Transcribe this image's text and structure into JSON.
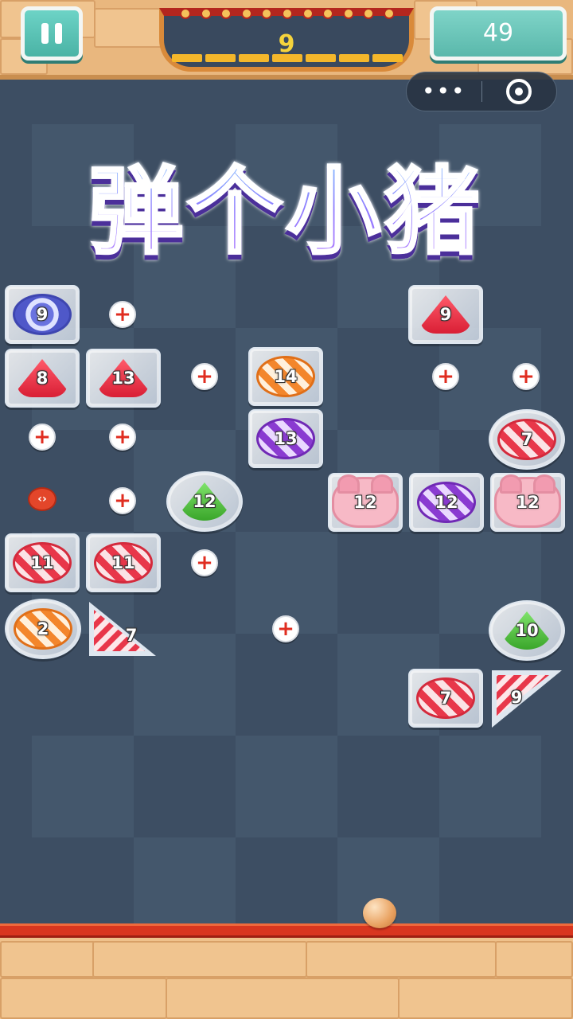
{
  "hud": {
    "level": "9",
    "balls_remaining": "49",
    "menu_more": "•••",
    "close_label": ""
  },
  "title": "弹个小猪",
  "blocks": [
    {
      "kind": "swirl",
      "value": "9"
    },
    {
      "kind": "gem-red",
      "value": "9"
    },
    {
      "kind": "gem-red",
      "value": "8"
    },
    {
      "kind": "gem-red",
      "value": "13"
    },
    {
      "kind": "candy-orange",
      "value": "14"
    },
    {
      "kind": "candy-purple",
      "value": "13"
    },
    {
      "kind": "candy-red",
      "value": "7"
    },
    {
      "kind": "gem-green",
      "value": "12"
    },
    {
      "kind": "pig",
      "value": "12"
    },
    {
      "kind": "candy-purple",
      "value": "12"
    },
    {
      "kind": "pig",
      "value": "12"
    },
    {
      "kind": "candy-red",
      "value": "11"
    },
    {
      "kind": "candy-red",
      "value": "11"
    },
    {
      "kind": "candy-orange",
      "value": "2"
    },
    {
      "kind": "striped-triangle",
      "value": "7"
    },
    {
      "kind": "gem-green",
      "value": "10"
    },
    {
      "kind": "candy-red",
      "value": "7"
    },
    {
      "kind": "striped-triangle",
      "value": "9"
    }
  ],
  "pickups": {
    "extra_ball_symbol": "+",
    "splitter_symbol": "‹›"
  },
  "colors": {
    "board": "#3d4e63",
    "accent_teal": "#5ab8ab",
    "floor_red": "#d9361f",
    "level_yellow": "#f5d33c"
  }
}
